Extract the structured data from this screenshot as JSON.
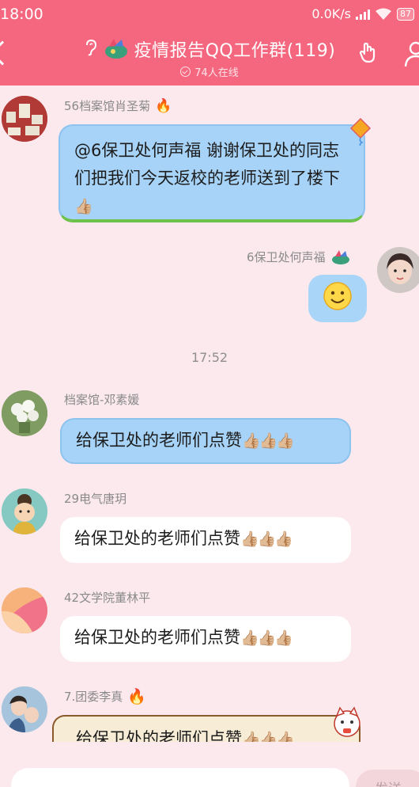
{
  "status": {
    "time": "18:00",
    "speed": "0.0K/s",
    "battery": "87"
  },
  "header": {
    "title": "疫情报告QQ工作群(119)",
    "online": "74人在线"
  },
  "messages": [
    {
      "sender": "56档案馆肖圣菊",
      "text": "@6保卫处何声福 谢谢保卫处的同志们把我们今天返校的老师送到了楼下"
    },
    {
      "sender": "6保卫处何声福",
      "emoji": "🙂"
    },
    {
      "sender": "档案馆-邓素媛",
      "text": "给保卫处的老师们点赞"
    },
    {
      "sender": "29电气唐玥",
      "text": "给保卫处的老师们点赞"
    },
    {
      "sender": "42文学院董林平",
      "text": "给保卫处的老师们点赞"
    },
    {
      "sender": "7.团委李真",
      "text": "给保卫处的老师们点赞"
    }
  ],
  "time_divider": "17:52",
  "thumbs": "👍🏼👍🏼👍🏼",
  "thumb_single": "👍🏼",
  "input": {
    "send_label": "发送"
  },
  "colors": {
    "header": "#f4677f",
    "background": "#fbe9ee",
    "bubble_blue": "#a6d3f7"
  }
}
